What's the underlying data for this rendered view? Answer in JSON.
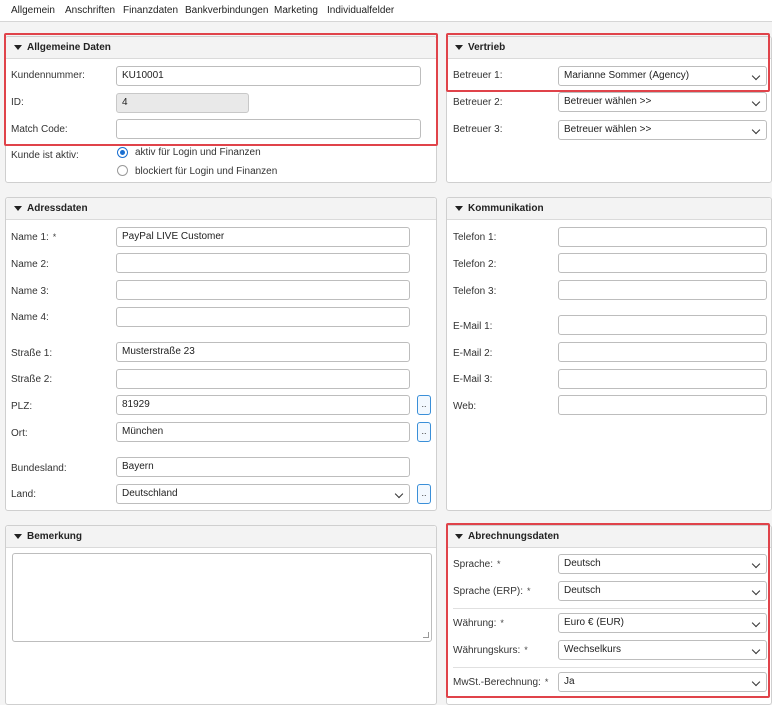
{
  "tabs": [
    "Allgemein",
    "Anschriften",
    "Finanzdaten",
    "Bankverbindungen",
    "Marketing",
    "Individualfelder"
  ],
  "allgemeine": {
    "title": "Allgemeine Daten",
    "kundennummer_label": "Kundennummer:",
    "kundennummer_value": "KU10001",
    "id_label": "ID:",
    "id_value": "4",
    "matchcode_label": "Match Code:",
    "matchcode_value": "",
    "aktiv_label": "Kunde ist aktiv:",
    "radio1": "aktiv für Login und Finanzen",
    "radio2": "blockiert für Login und Finanzen"
  },
  "vertrieb": {
    "title": "Vertrieb",
    "betreuer1_label": "Betreuer 1:",
    "betreuer1_value": "Marianne Sommer (Agency)",
    "betreuer2_label": "Betreuer 2:",
    "betreuer2_value": "Betreuer wählen >>",
    "betreuer3_label": "Betreuer 3:",
    "betreuer3_value": "Betreuer wählen >>"
  },
  "adress": {
    "title": "Adressdaten",
    "name1_label": "Name 1:",
    "name1_value": "PayPal LIVE Customer",
    "name2_label": "Name 2:",
    "name3_label": "Name 3:",
    "name4_label": "Name 4:",
    "strasse1_label": "Straße 1:",
    "strasse1_value": "Musterstraße 23",
    "strasse2_label": "Straße 2:",
    "plz_label": "PLZ:",
    "plz_value": "81929",
    "ort_label": "Ort:",
    "ort_value": "München",
    "bundesland_label": "Bundesland:",
    "bundesland_value": "Bayern",
    "land_label": "Land:",
    "land_value": "Deutschland",
    "dots_label": ".."
  },
  "komm": {
    "title": "Kommunikation",
    "telefon1_label": "Telefon 1:",
    "telefon2_label": "Telefon 2:",
    "telefon3_label": "Telefon 3:",
    "email1_label": "E-Mail 1:",
    "email2_label": "E-Mail 2:",
    "email3_label": "E-Mail 3:",
    "web_label": "Web:"
  },
  "bemerkung": {
    "title": "Bemerkung",
    "value": ""
  },
  "abrechnung": {
    "title": "Abrechnungsdaten",
    "sprache_label": "Sprache:",
    "sprache_value": "Deutsch",
    "sprache_erp_label": "Sprache (ERP):",
    "sprache_erp_value": "Deutsch",
    "waehrung_label": "Währung:",
    "waehrung_value": "Euro € (EUR)",
    "waehrungskurs_label": "Währungskurs:",
    "waehrungskurs_value": "Wechselkurs",
    "mwst_label": "MwSt.-Berechnung:",
    "mwst_value": "Ja"
  },
  "required_marker": "*",
  "colors": {
    "highlight": "#e0434a",
    "radio_selected": "#1a6fd1",
    "dots_border": "#3a8fd8"
  }
}
